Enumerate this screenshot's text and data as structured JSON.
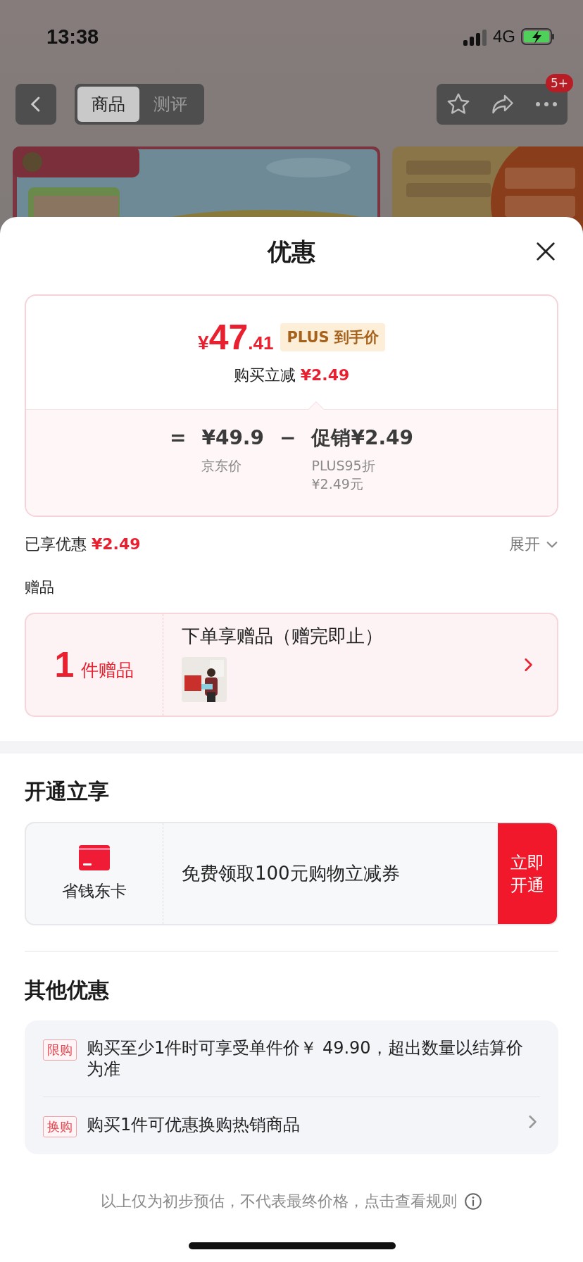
{
  "status_bar": {
    "time": "13:38",
    "network": "4G"
  },
  "nav": {
    "tabs": [
      {
        "label": "商品",
        "selected": true
      },
      {
        "label": "测评",
        "selected": false
      }
    ],
    "badge": "5+"
  },
  "sheet": {
    "title": "优惠",
    "price": {
      "currency": "¥",
      "integer": "47",
      "decimal": ".41",
      "tag": "PLUS 到手价",
      "reduce_label": "购买立减",
      "reduce_amount": "¥2.49"
    },
    "formula": {
      "equals": "=",
      "base_price": "¥49.9",
      "base_label": "京东价",
      "minus": "−",
      "promo": "促销¥2.49",
      "promo_notes": [
        "PLUS95折",
        "¥2.49元"
      ]
    },
    "savings": {
      "label": "已享优惠",
      "amount": "¥2.49",
      "toggle": "展开"
    },
    "gifts": {
      "title": "赠品",
      "count": "1",
      "unit": "件赠品",
      "headline": "下单享赠品（赠完即止）"
    },
    "membership": {
      "title": "开通立享",
      "card_name": "省钱东卡",
      "offer": "免费领取100元购物立减券",
      "button": "立即开通"
    },
    "others": {
      "title": "其他优惠",
      "items": [
        {
          "tag": "限购",
          "text": "购买至少1件时可享受单件价￥ 49.90，超出数量以结算价为准",
          "arrow": false
        },
        {
          "tag": "换购",
          "text": "购买1件可优惠换购热销商品",
          "arrow": true
        }
      ]
    },
    "footer": "以上仅为初步预估，不代表最终价格，点击查看规则"
  }
}
